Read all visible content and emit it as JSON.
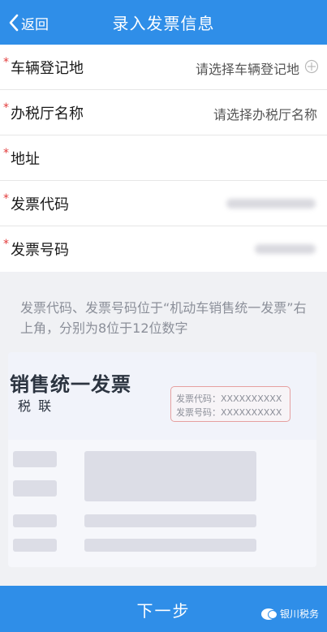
{
  "header": {
    "back_label": "返回",
    "title": "录入发票信息"
  },
  "form": {
    "required_mark": "*",
    "fields": [
      {
        "label": "车辆登记地",
        "placeholder": "请选择车辆登记地"
      },
      {
        "label": "办税厅名称",
        "placeholder": "请选择办税厅名称"
      },
      {
        "label": "地址",
        "value": ""
      },
      {
        "label": "发票代码",
        "value": "(redacted)"
      },
      {
        "label": "发票号码",
        "value": "(redacted)"
      }
    ]
  },
  "hint": "发票代码、发票号码位于“机动车销售统一发票”右上角，分别为8位于12位数字",
  "sample_invoice": {
    "title": "销售统一发票",
    "subtitle": "税 联",
    "code_line": "发票代码：XXXXXXXXXX",
    "number_line": "发票号码：XXXXXXXXXX"
  },
  "footer": {
    "next_label": "下一步",
    "watermark": "银川税务"
  },
  "colors": {
    "primary": "#2f8ee8",
    "required": "#e23b3b"
  }
}
